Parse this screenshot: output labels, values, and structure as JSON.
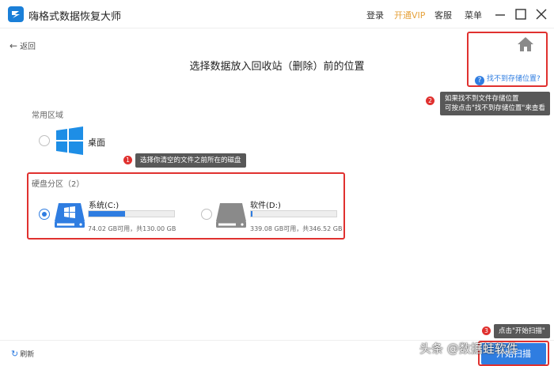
{
  "app": {
    "title": "嗨格式数据恢复大师"
  },
  "nav": {
    "login": "登录",
    "vip": "开通VIP",
    "service": "客服",
    "menu": "菜单"
  },
  "back_label": "返回",
  "page_title": "选择数据放入回收站（删除）前的位置",
  "help_link": "找不到存储位置?",
  "tips": {
    "t1_num": "1",
    "t1": "选择你清空的文件之前所在的磁盘",
    "t2_num": "2",
    "t2_line1": "如果找不到文件存储位置",
    "t2_line2": "可按点击\"找不到存储位置\"来查看",
    "t3_num": "3",
    "t3": "点击\"开始扫描\""
  },
  "common": {
    "label": "常用区域",
    "desktop": {
      "label": "桌面",
      "selected": false
    }
  },
  "disks": {
    "label": "硬盘分区（2）",
    "items": [
      {
        "name": "系统(C:)",
        "info": "74.02 GB可用，共130.00 GB",
        "used_fraction": 0.43,
        "selected": true
      },
      {
        "name": "软件(D:)",
        "info": "339.08 GB可用，共346.52 GB",
        "used_fraction": 0.02,
        "selected": false
      }
    ]
  },
  "refresh_label": "刷新",
  "start_button": "开始扫描",
  "watermark": "头条 @数据蛙软件",
  "colors": {
    "accent": "#2f7de1",
    "annotation_red": "#e0312f",
    "vip": "#e6a23c",
    "windows_blue": "#1e8ee6"
  },
  "icons": {
    "app": "app-logo-icon",
    "home": "home-icon",
    "desktop": "windows-logo-icon",
    "drive_c": "system-drive-icon",
    "drive_d": "hard-drive-icon",
    "refresh": "refresh-icon",
    "help": "question-icon"
  }
}
